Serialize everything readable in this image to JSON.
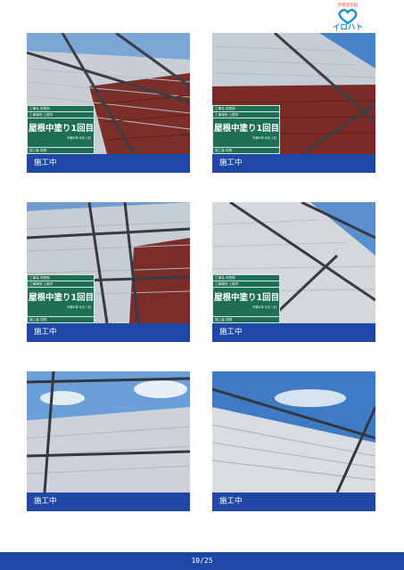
{
  "logo": {
    "tagline": "外壁塗装館",
    "name": "イロハト",
    "colors": {
      "accent": "#1e8fd6",
      "tag": "#e2452b"
    }
  },
  "photos": [
    {
      "caption": "施工中",
      "board": {
        "line1": "工事名:安野邸",
        "line2": "工事場所:上尾市",
        "title": "屋根中塗り1回目",
        "date": "令和5年 8月 1日",
        "footer": "施工者:安野"
      }
    },
    {
      "caption": "施工中",
      "board": {
        "line1": "工事名:安野邸",
        "line2": "工事場所:上尾市",
        "title": "屋根中塗り1回目",
        "date": "令和5年 8月 1日",
        "footer": "施工者:安野"
      }
    },
    {
      "caption": "施工中",
      "board": {
        "line1": "工事名:安野邸",
        "line2": "工事場所:上尾市",
        "title": "屋根中塗り1回目",
        "date": "令和5年 8月 1日",
        "footer": "施工者:安野"
      }
    },
    {
      "caption": "施工中",
      "board": {
        "line1": "工事名:安野邸",
        "line2": "工事場所:上尾市",
        "title": "屋根中塗り1回目",
        "date": "令和5年 8月 1日",
        "footer": "施工者:安野"
      }
    },
    {
      "caption": "施工中"
    },
    {
      "caption": "施工中"
    }
  ],
  "footer": {
    "page": "10/25",
    "color": "#1e47a6"
  }
}
